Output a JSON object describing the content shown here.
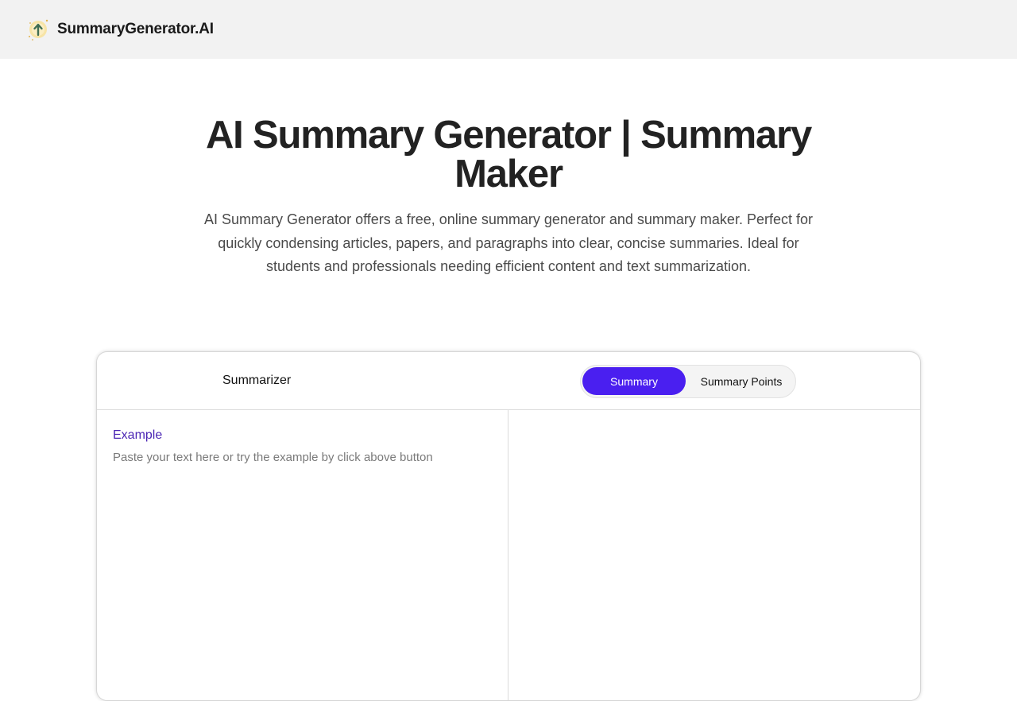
{
  "header": {
    "brand": "SummaryGenerator.AI",
    "logo_icon": "lightbulb-arrow-icon"
  },
  "hero": {
    "title": "AI Summary Generator | Summary Maker",
    "description": "AI Summary Generator offers a free, online summary generator and summary maker. Perfect for quickly condensing articles, papers, and paragraphs into clear, concise summaries. Ideal for students and professionals needing efficient content and text summarization."
  },
  "summarizer": {
    "title": "Summarizer",
    "modes": [
      {
        "label": "Summary",
        "active": true
      },
      {
        "label": "Summary Points",
        "active": false
      }
    ],
    "example_label": "Example",
    "input": {
      "value": "",
      "placeholder": "Paste your text here or try the example by click above button"
    },
    "output": ""
  },
  "colors": {
    "accent": "#4a1ff0",
    "link": "#4b26b4",
    "header_bg": "#f2f2f2"
  }
}
